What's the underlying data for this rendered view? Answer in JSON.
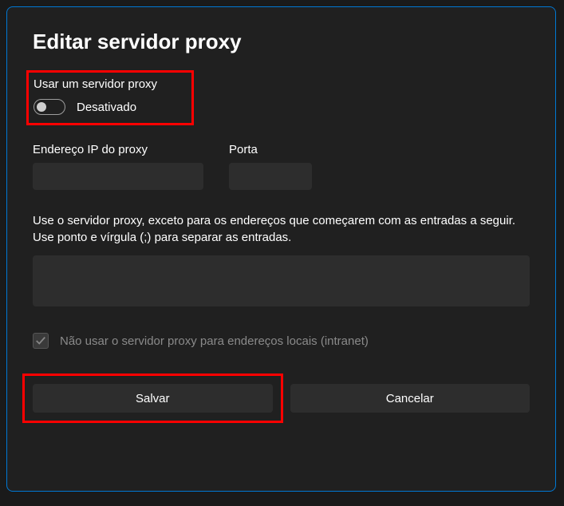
{
  "dialog": {
    "title": "Editar servidor proxy"
  },
  "toggle": {
    "label": "Usar um servidor proxy",
    "state": "Desativado"
  },
  "fields": {
    "ip_label": "Endereço IP do proxy",
    "ip_value": "",
    "port_label": "Porta",
    "port_value": ""
  },
  "exceptions": {
    "description": "Use o servidor proxy, exceto para os endereços que começarem com as entradas a seguir. Use ponto e vírgula (;) para separar as entradas.",
    "value": ""
  },
  "checkbox": {
    "label": "Não usar o servidor proxy para endereços locais (intranet)"
  },
  "buttons": {
    "save_label": "Salvar",
    "cancel_label": "Cancelar"
  }
}
